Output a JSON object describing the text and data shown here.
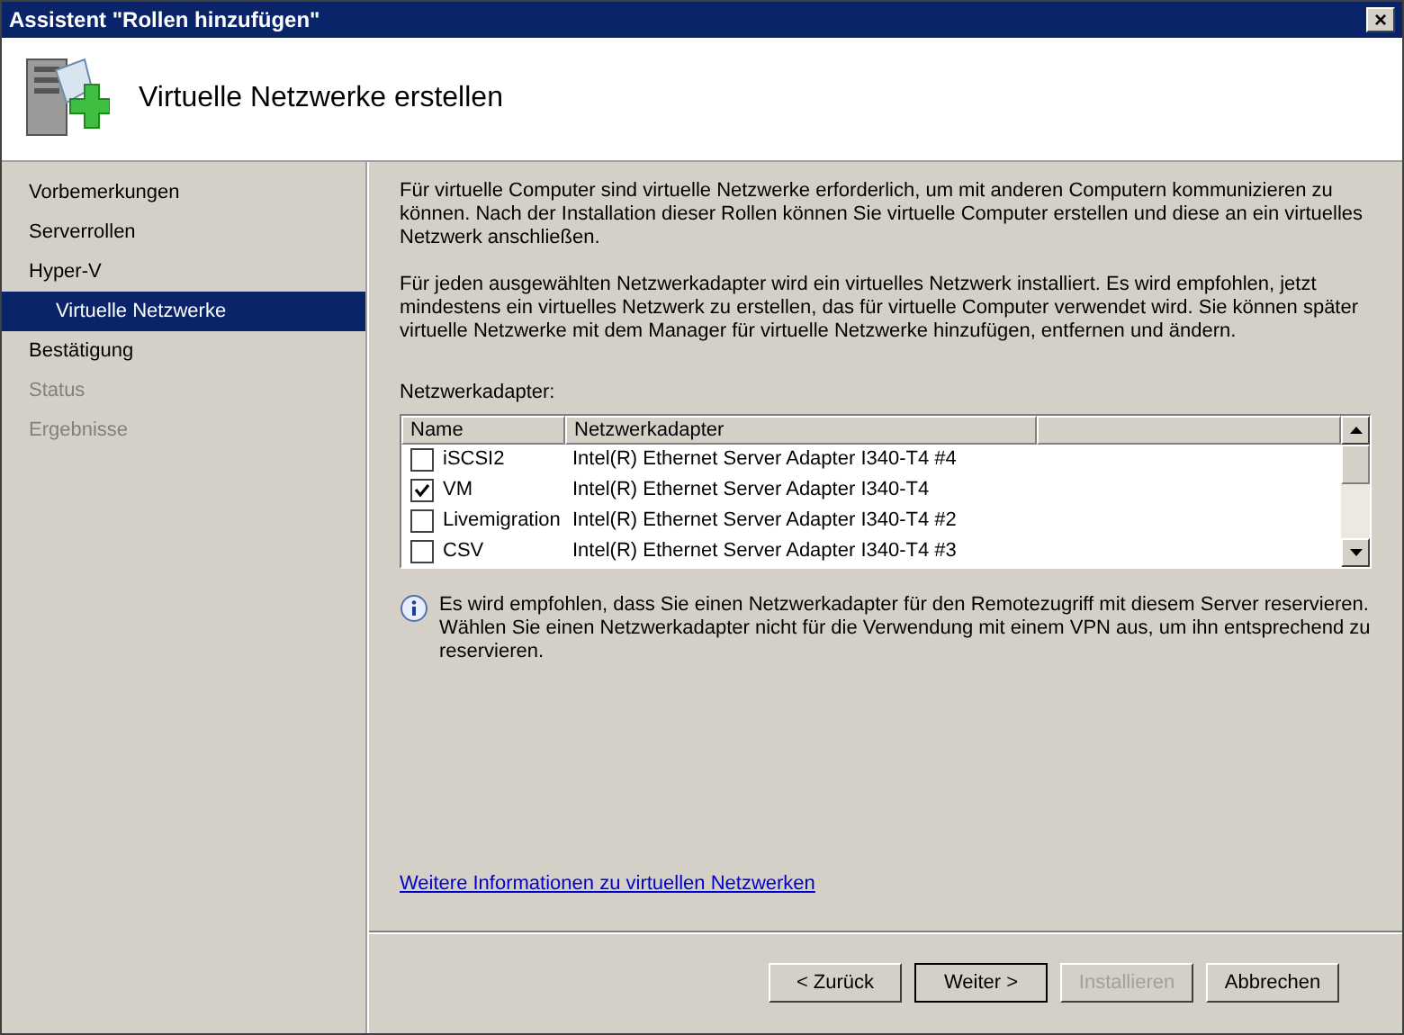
{
  "window": {
    "title": "Assistent \"Rollen hinzufügen\"",
    "close": "×"
  },
  "header": {
    "title": "Virtuelle Netzwerke erstellen"
  },
  "sidebar": {
    "items": [
      {
        "label": "Vorbemerkungen",
        "selected": false,
        "disabled": false
      },
      {
        "label": "Serverrollen",
        "selected": false,
        "disabled": false
      },
      {
        "label": "Hyper-V",
        "selected": false,
        "disabled": false,
        "children": [
          {
            "label": "Virtuelle Netzwerke",
            "selected": true
          }
        ]
      },
      {
        "label": "Bestätigung",
        "selected": false,
        "disabled": false
      },
      {
        "label": "Status",
        "selected": false,
        "disabled": true
      },
      {
        "label": "Ergebnisse",
        "selected": false,
        "disabled": true
      }
    ]
  },
  "paragraphs": [
    "Für virtuelle Computer sind virtuelle Netzwerke erforderlich, um mit anderen Computern kommunizieren zu können. Nach der Installation dieser Rollen können Sie virtuelle Computer erstellen und diese an ein virtuelles Netzwerk anschließen.",
    "Für jeden ausgewählten Netzwerkadapter wird ein virtuelles Netzwerk installiert. Es wird empfohlen, jetzt mindestens ein virtuelles Netzwerk zu erstellen, das für virtuelle Computer verwendet wird. Sie können später virtuelle Netzwerke mit dem Manager für virtuelle Netzwerke hinzufügen, entfernen und ändern."
  ],
  "adapters": {
    "label": "Netzwerkadapter:",
    "columns": [
      "Name",
      "Netzwerkadapter"
    ],
    "rows": [
      {
        "name": "iSCSI2",
        "adapter": "Intel(R) Ethernet Server Adapter I340-T4 #4",
        "checked": false
      },
      {
        "name": "VM",
        "adapter": "Intel(R) Ethernet Server Adapter I340-T4",
        "checked": true
      },
      {
        "name": "Livemigration",
        "adapter": "Intel(R) Ethernet Server Adapter I340-T4 #2",
        "checked": false
      },
      {
        "name": "CSV",
        "adapter": "Intel(R) Ethernet Server Adapter I340-T4 #3",
        "checked": false
      }
    ]
  },
  "info": "Es wird empfohlen, dass Sie einen Netzwerkadapter für den Remotezugriff mit diesem Server reservieren. Wählen Sie einen Netzwerkadapter nicht für die Verwendung mit einem VPN aus, um ihn entsprechend zu reservieren.",
  "link": "Weitere Informationen zu virtuellen Netzwerken",
  "buttons": [
    {
      "label": "< Zurück",
      "disabled": false,
      "default": false
    },
    {
      "label": "Weiter >",
      "disabled": false,
      "default": true
    },
    {
      "label": "Installieren",
      "disabled": true,
      "default": false
    },
    {
      "label": "Abbrechen",
      "disabled": false,
      "default": false
    }
  ]
}
